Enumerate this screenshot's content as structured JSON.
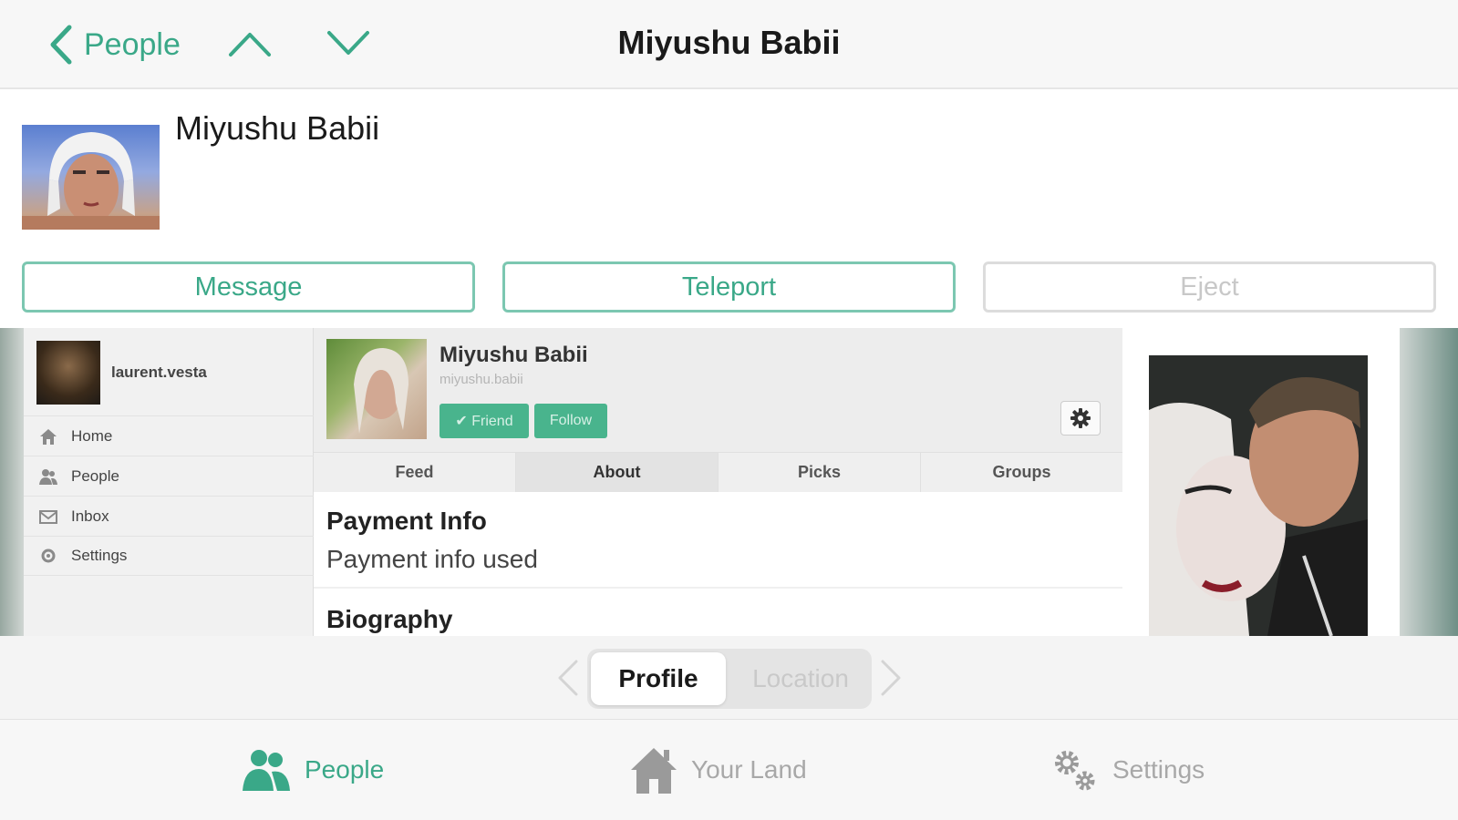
{
  "nav": {
    "back_label": "People",
    "title": "Miyushu Babii"
  },
  "profile": {
    "name": "Miyushu Babii",
    "actions": [
      {
        "label": "Message",
        "enabled": true
      },
      {
        "label": "Teleport",
        "enabled": true
      },
      {
        "label": "Eject",
        "enabled": false
      }
    ]
  },
  "web": {
    "sidebar": {
      "username": "laurent.vesta",
      "items": [
        {
          "label": "Home",
          "icon": "home-icon"
        },
        {
          "label": "People",
          "icon": "people-icon"
        },
        {
          "label": "Inbox",
          "icon": "inbox-icon"
        },
        {
          "label": "Settings",
          "icon": "settings-icon"
        }
      ]
    },
    "profile": {
      "name": "Miyushu Babii",
      "handle": "miyushu.babii",
      "friend_label": "✔ Friend",
      "follow_label": "Follow"
    },
    "tabs": [
      {
        "label": "Feed",
        "active": false
      },
      {
        "label": "About",
        "active": true
      },
      {
        "label": "Picks",
        "active": false
      },
      {
        "label": "Groups",
        "active": false
      }
    ],
    "about": {
      "payment_title": "Payment Info",
      "payment_text": "Payment info used",
      "biography_title": "Biography"
    }
  },
  "segment": {
    "selected": "Profile",
    "options": [
      "Profile",
      "Location"
    ]
  },
  "tabbar": {
    "items": [
      {
        "label": "People",
        "icon": "people-icon",
        "active": true
      },
      {
        "label": "Your Land",
        "icon": "house-icon",
        "active": false
      },
      {
        "label": "Settings",
        "icon": "gears-icon",
        "active": false
      }
    ]
  },
  "colors": {
    "accent": "#3aa888",
    "accent_border": "#7cc7b1",
    "disabled": "#c8c8c8",
    "pill_green": "#49b48d"
  }
}
